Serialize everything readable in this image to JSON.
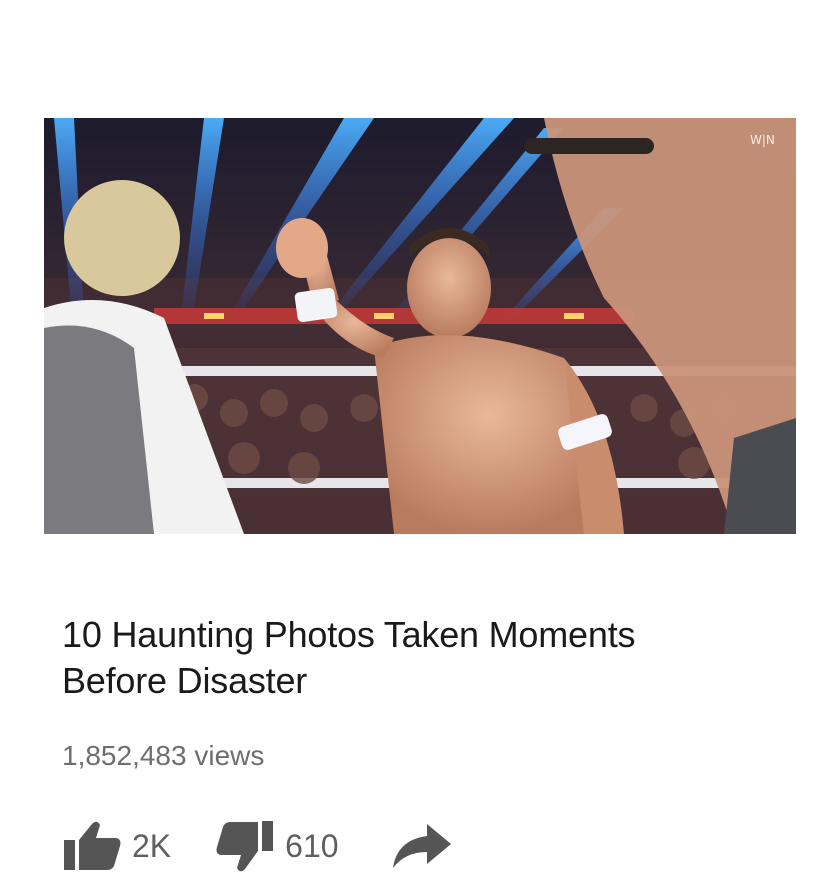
{
  "video": {
    "thumbnail_icon": "video-thumbnail",
    "watermark": "W|N",
    "title": "10 Haunting Photos Taken Moments Before Disaster",
    "views": "1,852,483 views"
  },
  "actions": {
    "like": {
      "icon": "thumbs-up-icon",
      "count": "2K"
    },
    "dislike": {
      "icon": "thumbs-down-icon",
      "count": "610"
    },
    "share": {
      "icon": "share-arrow-icon"
    }
  },
  "colors": {
    "title": "#1a1a1a",
    "meta": "#6e6e6e",
    "icon": "#5a5a5a"
  }
}
